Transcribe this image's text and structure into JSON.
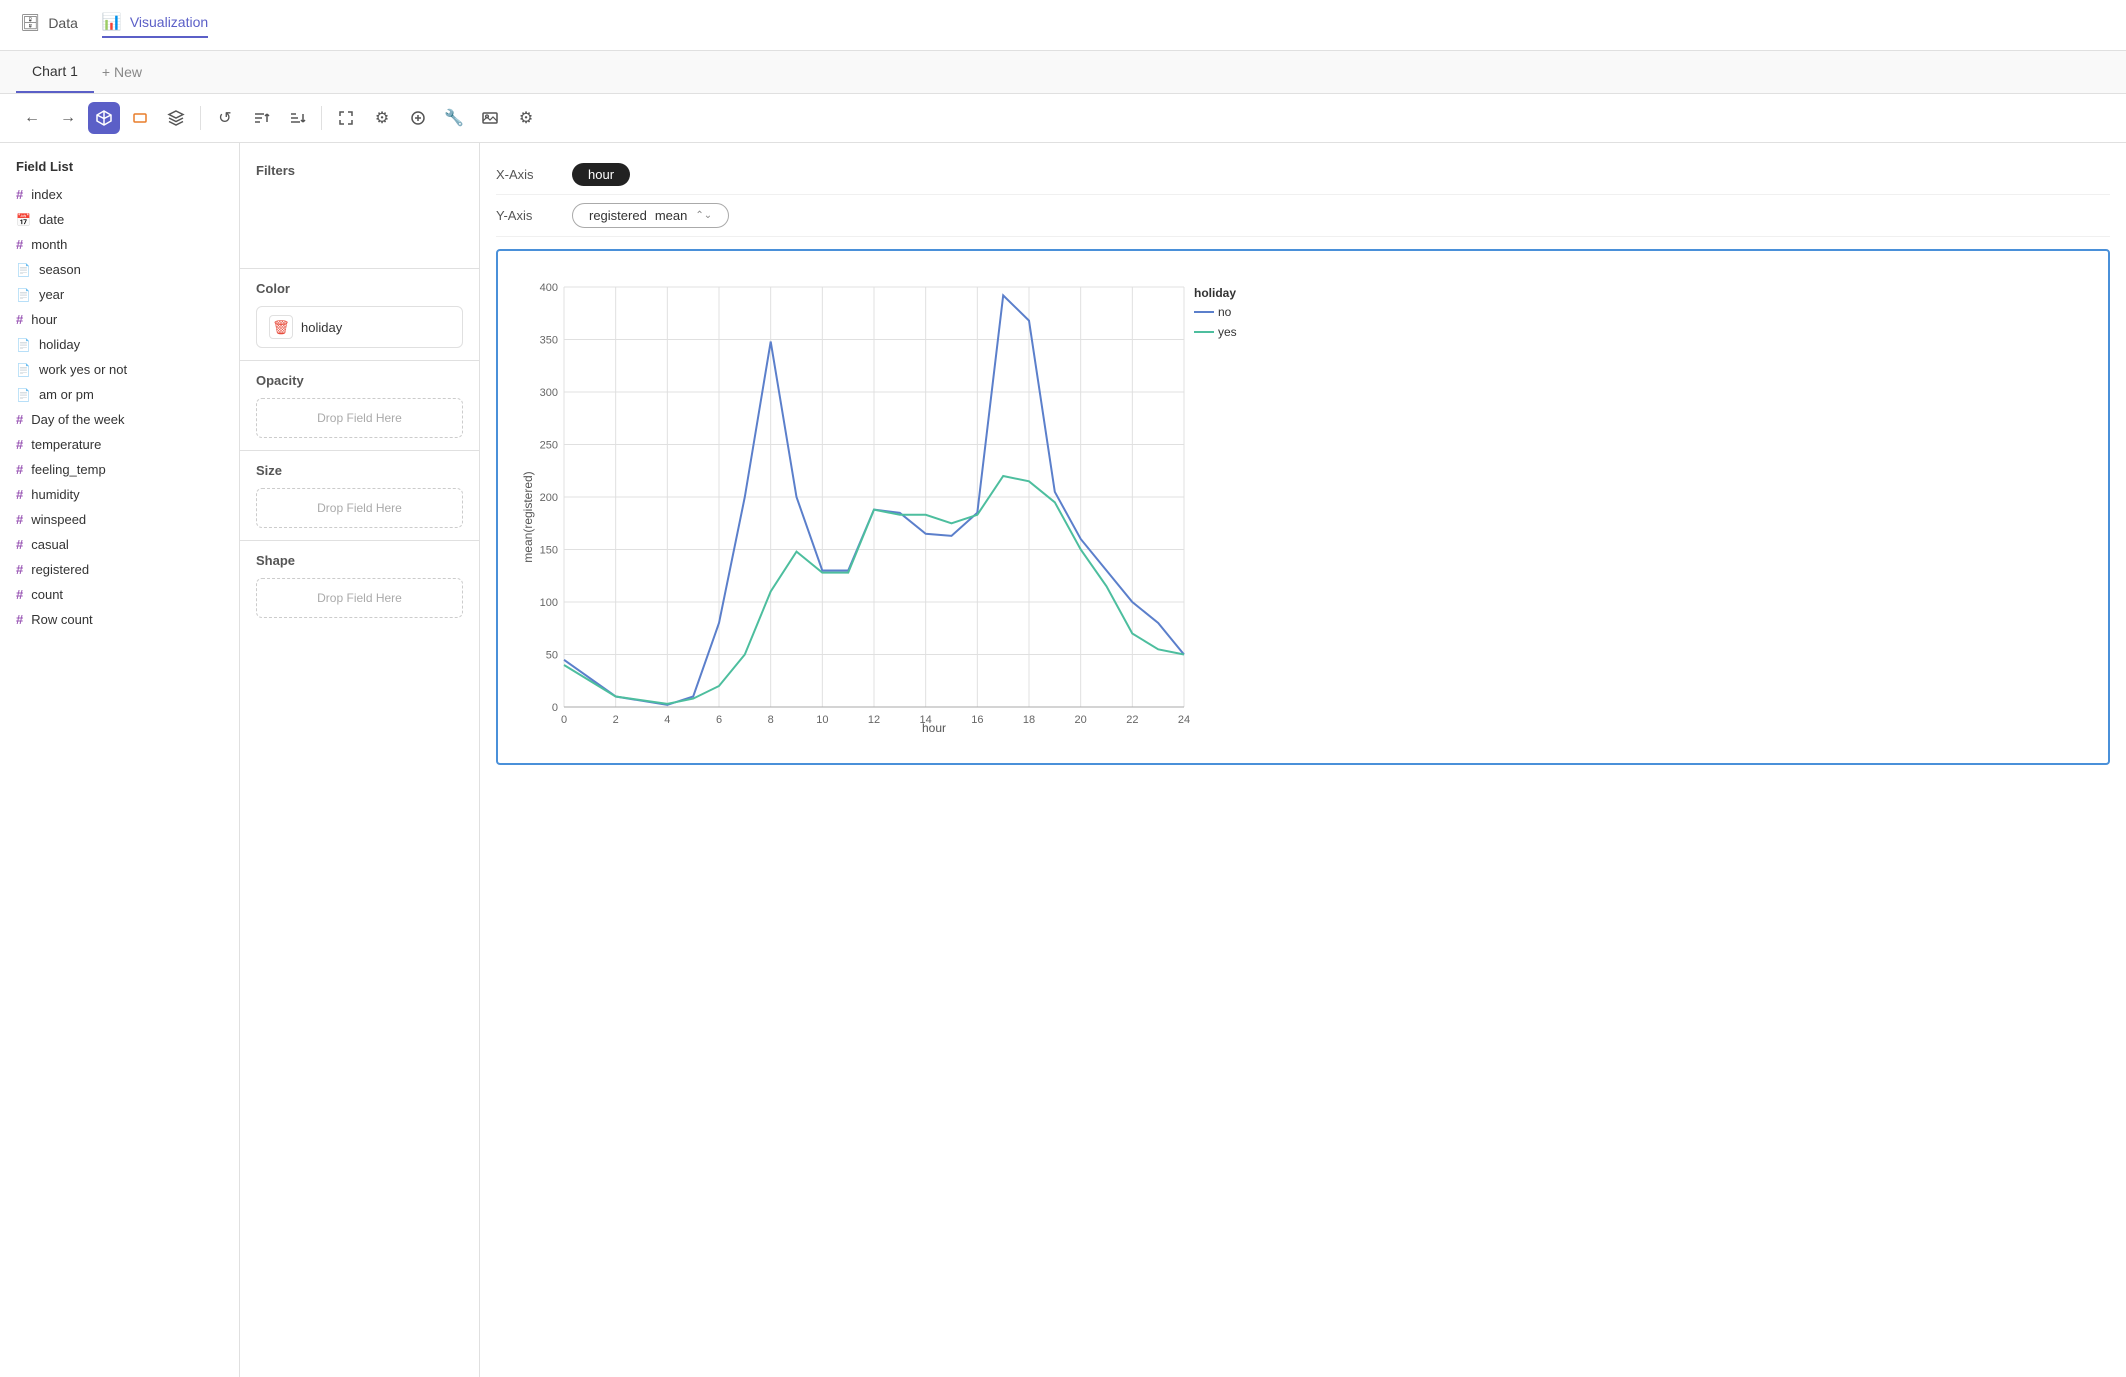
{
  "nav": {
    "items": [
      {
        "id": "data",
        "label": "Data",
        "icon": "🗄",
        "active": false
      },
      {
        "id": "visualization",
        "label": "Visualization",
        "icon": "📊",
        "active": true
      }
    ]
  },
  "tabs": [
    {
      "id": "chart1",
      "label": "Chart 1",
      "active": true
    },
    {
      "id": "new",
      "label": "+ New",
      "active": false
    }
  ],
  "toolbar": {
    "buttons": [
      {
        "id": "back",
        "icon": "←",
        "active": false,
        "label": "Back"
      },
      {
        "id": "forward",
        "icon": "→",
        "active": false,
        "label": "Forward"
      },
      {
        "id": "cube",
        "icon": "⬡",
        "active": true,
        "label": "Cube"
      },
      {
        "id": "rect",
        "icon": "▭",
        "active": false,
        "label": "Rectangle"
      },
      {
        "id": "layers",
        "icon": "⧉",
        "active": false,
        "label": "Layers"
      },
      {
        "id": "refresh",
        "icon": "↺",
        "active": false,
        "label": "Refresh"
      },
      {
        "id": "sort-asc",
        "icon": "↑≡",
        "active": false,
        "label": "Sort ascending"
      },
      {
        "id": "sort-desc",
        "icon": "↓≡",
        "active": false,
        "label": "Sort descending"
      },
      {
        "id": "expand",
        "icon": "⤢",
        "active": false,
        "label": "Expand"
      },
      {
        "id": "settings",
        "icon": "⚙",
        "active": false,
        "label": "Settings"
      },
      {
        "id": "transform",
        "icon": "⊕",
        "active": false,
        "label": "Transform"
      },
      {
        "id": "wrench",
        "icon": "🔧",
        "active": false,
        "label": "Wrench"
      },
      {
        "id": "image",
        "icon": "🖼",
        "active": false,
        "label": "Image"
      },
      {
        "id": "config",
        "icon": "⚙",
        "active": false,
        "label": "Config"
      }
    ]
  },
  "field_list": {
    "title": "Field List",
    "fields": [
      {
        "name": "index",
        "type": "numeric"
      },
      {
        "name": "date",
        "type": "date"
      },
      {
        "name": "month",
        "type": "numeric"
      },
      {
        "name": "season",
        "type": "categorical"
      },
      {
        "name": "year",
        "type": "categorical"
      },
      {
        "name": "hour",
        "type": "numeric"
      },
      {
        "name": "holiday",
        "type": "categorical"
      },
      {
        "name": "work yes or not",
        "type": "categorical"
      },
      {
        "name": "am or pm",
        "type": "categorical"
      },
      {
        "name": "Day of the week",
        "type": "numeric"
      },
      {
        "name": "temperature",
        "type": "numeric"
      },
      {
        "name": "feeling_temp",
        "type": "numeric"
      },
      {
        "name": "humidity",
        "type": "numeric"
      },
      {
        "name": "winspeed",
        "type": "numeric"
      },
      {
        "name": "casual",
        "type": "numeric"
      },
      {
        "name": "registered",
        "type": "numeric"
      },
      {
        "name": "count",
        "type": "numeric"
      },
      {
        "name": "Row count",
        "type": "numeric"
      }
    ]
  },
  "controls": {
    "filters_title": "Filters",
    "color_title": "Color",
    "color_field": "holiday",
    "opacity_title": "Opacity",
    "size_title": "Size",
    "shape_title": "Shape",
    "drop_placeholder": "Drop Field Here"
  },
  "axes": {
    "x_label": "X-Axis",
    "x_value": "hour",
    "y_label": "Y-Axis",
    "y_field": "registered",
    "y_agg": "mean"
  },
  "chart": {
    "title": "Line chart",
    "x_axis_label": "hour",
    "y_axis_label": "mean(registered)",
    "y_max": 400,
    "y_min": 0,
    "x_max": 24,
    "x_min": 0,
    "legend_title": "holiday",
    "series": [
      {
        "name": "no",
        "color": "#5b7fcb",
        "points": [
          [
            0,
            45
          ],
          [
            2,
            10
          ],
          [
            4,
            2
          ],
          [
            5,
            10
          ],
          [
            6,
            80
          ],
          [
            7,
            200
          ],
          [
            8,
            348
          ],
          [
            9,
            200
          ],
          [
            10,
            130
          ],
          [
            11,
            130
          ],
          [
            12,
            188
          ],
          [
            13,
            185
          ],
          [
            14,
            165
          ],
          [
            15,
            163
          ],
          [
            16,
            185
          ],
          [
            17,
            392
          ],
          [
            18,
            368
          ],
          [
            19,
            205
          ],
          [
            20,
            160
          ],
          [
            21,
            130
          ],
          [
            22,
            100
          ],
          [
            23,
            80
          ],
          [
            24,
            50
          ]
        ]
      },
      {
        "name": "yes",
        "color": "#4dbe9e",
        "points": [
          [
            0,
            40
          ],
          [
            2,
            10
          ],
          [
            4,
            3
          ],
          [
            5,
            8
          ],
          [
            6,
            20
          ],
          [
            7,
            50
          ],
          [
            8,
            110
          ],
          [
            9,
            148
          ],
          [
            10,
            128
          ],
          [
            11,
            128
          ],
          [
            12,
            188
          ],
          [
            13,
            183
          ],
          [
            14,
            183
          ],
          [
            15,
            175
          ],
          [
            16,
            183
          ],
          [
            17,
            220
          ],
          [
            18,
            215
          ],
          [
            19,
            195
          ],
          [
            20,
            150
          ],
          [
            21,
            115
          ],
          [
            22,
            70
          ],
          [
            23,
            55
          ],
          [
            24,
            50
          ]
        ]
      }
    ]
  }
}
